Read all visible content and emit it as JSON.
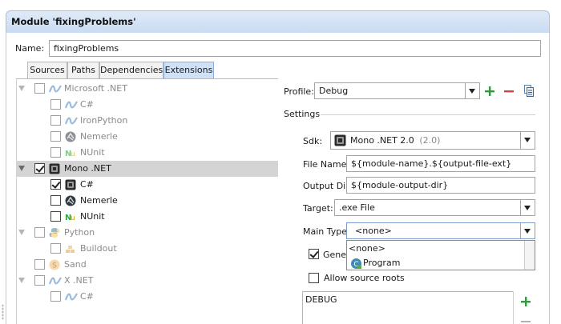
{
  "window": {
    "title": "Module 'fixingProblems'"
  },
  "module": {
    "name_label": "Name:",
    "name_value": "fixingProblems"
  },
  "tabs": [
    {
      "label": "Sources",
      "active": false
    },
    {
      "label": "Paths",
      "active": false
    },
    {
      "label": "Dependencies",
      "active": false
    },
    {
      "label": "Extensions",
      "active": true
    }
  ],
  "tree": [
    {
      "label": "Microsoft .NET",
      "icon": "dotnet-icon",
      "checked": false,
      "enabled": false,
      "level": 0,
      "expanded": true
    },
    {
      "label": "C#",
      "icon": "dotnet-icon",
      "checked": false,
      "enabled": false,
      "level": 1
    },
    {
      "label": "IronPython",
      "icon": "dotnet-icon",
      "checked": false,
      "enabled": false,
      "level": 1
    },
    {
      "label": "Nemerle",
      "icon": "nemerle-icon",
      "checked": false,
      "enabled": false,
      "level": 1
    },
    {
      "label": "NUnit",
      "icon": "nunit-icon",
      "checked": false,
      "enabled": false,
      "level": 1
    },
    {
      "label": "Mono .NET",
      "icon": "mono-icon",
      "checked": true,
      "enabled": true,
      "level": 0,
      "expanded": true,
      "selected": true
    },
    {
      "label": "C#",
      "icon": "mono-icon",
      "checked": true,
      "enabled": true,
      "level": 1
    },
    {
      "label": "Nemerle",
      "icon": "nemerle-icon",
      "checked": false,
      "enabled": true,
      "level": 1
    },
    {
      "label": "NUnit",
      "icon": "nunit-icon",
      "checked": false,
      "enabled": true,
      "level": 1
    },
    {
      "label": "Python",
      "icon": "python-icon",
      "checked": false,
      "enabled": false,
      "level": 0,
      "expanded": true
    },
    {
      "label": "Buildout",
      "icon": "buildout-icon",
      "checked": false,
      "enabled": false,
      "level": 1
    },
    {
      "label": "Sand",
      "icon": "sand-icon",
      "checked": false,
      "enabled": false,
      "level": 0,
      "expanded": false
    },
    {
      "label": "X .NET",
      "icon": "dotnet-icon",
      "checked": false,
      "enabled": false,
      "level": 0,
      "expanded": true
    },
    {
      "label": "C#",
      "icon": "dotnet-icon",
      "checked": false,
      "enabled": false,
      "level": 1
    }
  ],
  "profile": {
    "label": "Profile:",
    "value": "Debug"
  },
  "settings": {
    "header": "Settings",
    "sdk_label": "Sdk:",
    "sdk_value": "Mono .NET 2.0",
    "sdk_version": "(2.0)",
    "file_name_label": "File Name:",
    "file_name_value": "${module-name}.${output-file-ext}",
    "output_dir_label": "Output Dir:",
    "output_dir_value": "${module-output-dir}",
    "target_label": "Target:",
    "target_value": ".exe File",
    "main_type_label": "Main Type:",
    "main_type_value": "<none>",
    "main_type_options": [
      "<none>",
      "Program"
    ],
    "generate_label": "Gener",
    "generate_checked": true,
    "allow_source_roots_label": "Allow source roots",
    "allow_source_roots_checked": false,
    "defines_value": "DEBUG"
  },
  "colors": {
    "add": "#2e9e3a",
    "remove": "#d0453b",
    "title_bg": "#cfdff4",
    "selected_row": "#d4d4d4"
  }
}
